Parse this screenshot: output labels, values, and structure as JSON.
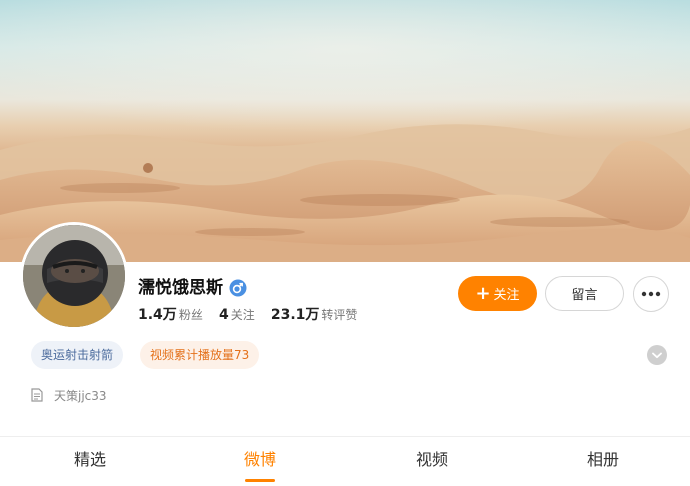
{
  "profile": {
    "name": "濡悦饿思斯",
    "stats": [
      {
        "value": "1.4万",
        "label": "粉丝"
      },
      {
        "value": "4",
        "label": "关注"
      },
      {
        "value": "23.1万",
        "label": "转评赞"
      }
    ],
    "follow_label": "关注",
    "message_label": "留言",
    "tags": [
      "奥运射击射箭",
      "视频累计播放量73"
    ],
    "info_text": "天策jjc33"
  },
  "tabs": [
    {
      "label": "精选",
      "active": false
    },
    {
      "label": "微博",
      "active": true
    },
    {
      "label": "视频",
      "active": false
    },
    {
      "label": "相册",
      "active": false
    }
  ],
  "colors": {
    "accent": "#ff8200",
    "verified": "#4a90e2"
  },
  "icons": {
    "verified": "verified-icon",
    "more": "more-icon",
    "expand": "chevron-down-icon",
    "info": "doc-icon"
  }
}
